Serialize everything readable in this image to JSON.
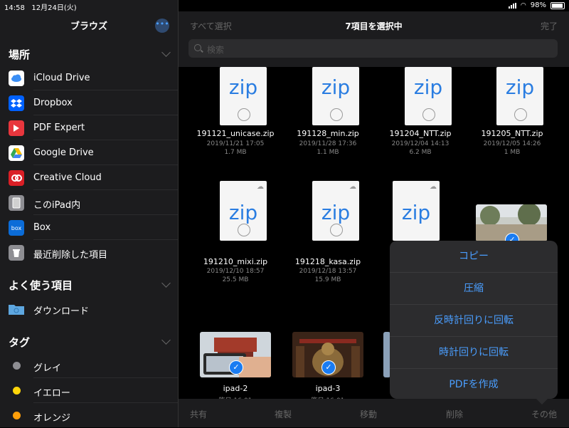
{
  "status_bar": {
    "time": "14:58",
    "date": "12月24日(火)",
    "battery": "98%"
  },
  "sidebar": {
    "title": "ブラウズ",
    "more_button": "•••",
    "sections": {
      "locations": "場所",
      "favorites": "よく使う項目",
      "tags": "タグ"
    },
    "locations": [
      {
        "label": "iCloud Drive",
        "icon": "icloud-icon"
      },
      {
        "label": "Dropbox",
        "icon": "dropbox-icon"
      },
      {
        "label": "PDF Expert",
        "icon": "pdf-expert-icon"
      },
      {
        "label": "Google Drive",
        "icon": "google-drive-icon"
      },
      {
        "label": "Creative Cloud",
        "icon": "creative-cloud-icon"
      },
      {
        "label": "このiPad内",
        "icon": "ipad-icon"
      },
      {
        "label": "Box",
        "icon": "box-icon"
      },
      {
        "label": "最近削除した項目",
        "icon": "trash-icon"
      }
    ],
    "favorites": [
      {
        "label": "ダウンロード",
        "icon": "download-folder-icon"
      }
    ],
    "tags": [
      {
        "label": "グレイ",
        "color": "#8e8e93"
      },
      {
        "label": "イエロー",
        "color": "#ffd60a"
      },
      {
        "label": "オレンジ",
        "color": "#ff9f0a"
      }
    ]
  },
  "main": {
    "select_all": "すべて選択",
    "title": "7項目を選択中",
    "done": "完了",
    "search_placeholder": "検索",
    "files": [
      {
        "name": "191121_unicase.zip",
        "date": "2019/11/21 17:05",
        "size": "1.7 MB",
        "thumb": "zip"
      },
      {
        "name": "191128_min.zip",
        "date": "2019/11/28 17:36",
        "size": "1.1 MB",
        "thumb": "zip"
      },
      {
        "name": "191204_NTT.zip",
        "date": "2019/12/04 14:13",
        "size": "6.2 MB",
        "thumb": "zip"
      },
      {
        "name": "191205_NTT.zip",
        "date": "2019/12/05 14:26",
        "size": "1 MB",
        "thumb": "zip"
      },
      {
        "name": "191210_mixi.zip",
        "date": "2019/12/10 18:57",
        "size": "25.5 MB",
        "thumb": "zip"
      },
      {
        "name": "191218_kasa.zip",
        "date": "2019/12/18 13:57",
        "size": "15.9 MB",
        "thumb": "zip"
      },
      {
        "name": "ipad-2",
        "date": "昨日 16:01"
      },
      {
        "name": "ipad-3",
        "date": "昨日 16:01"
      }
    ]
  },
  "toolbar": {
    "share": "共有",
    "duplicate": "複製",
    "move": "移動",
    "delete": "削除",
    "more": "その他"
  },
  "popover": {
    "items": [
      "コピー",
      "圧縮",
      "反時計回りに回転",
      "時計回りに回転",
      "PDFを作成"
    ]
  },
  "colors": {
    "accent": "#4a9eff",
    "check": "#1a7cf2",
    "zip_text": "#2a7de1"
  }
}
